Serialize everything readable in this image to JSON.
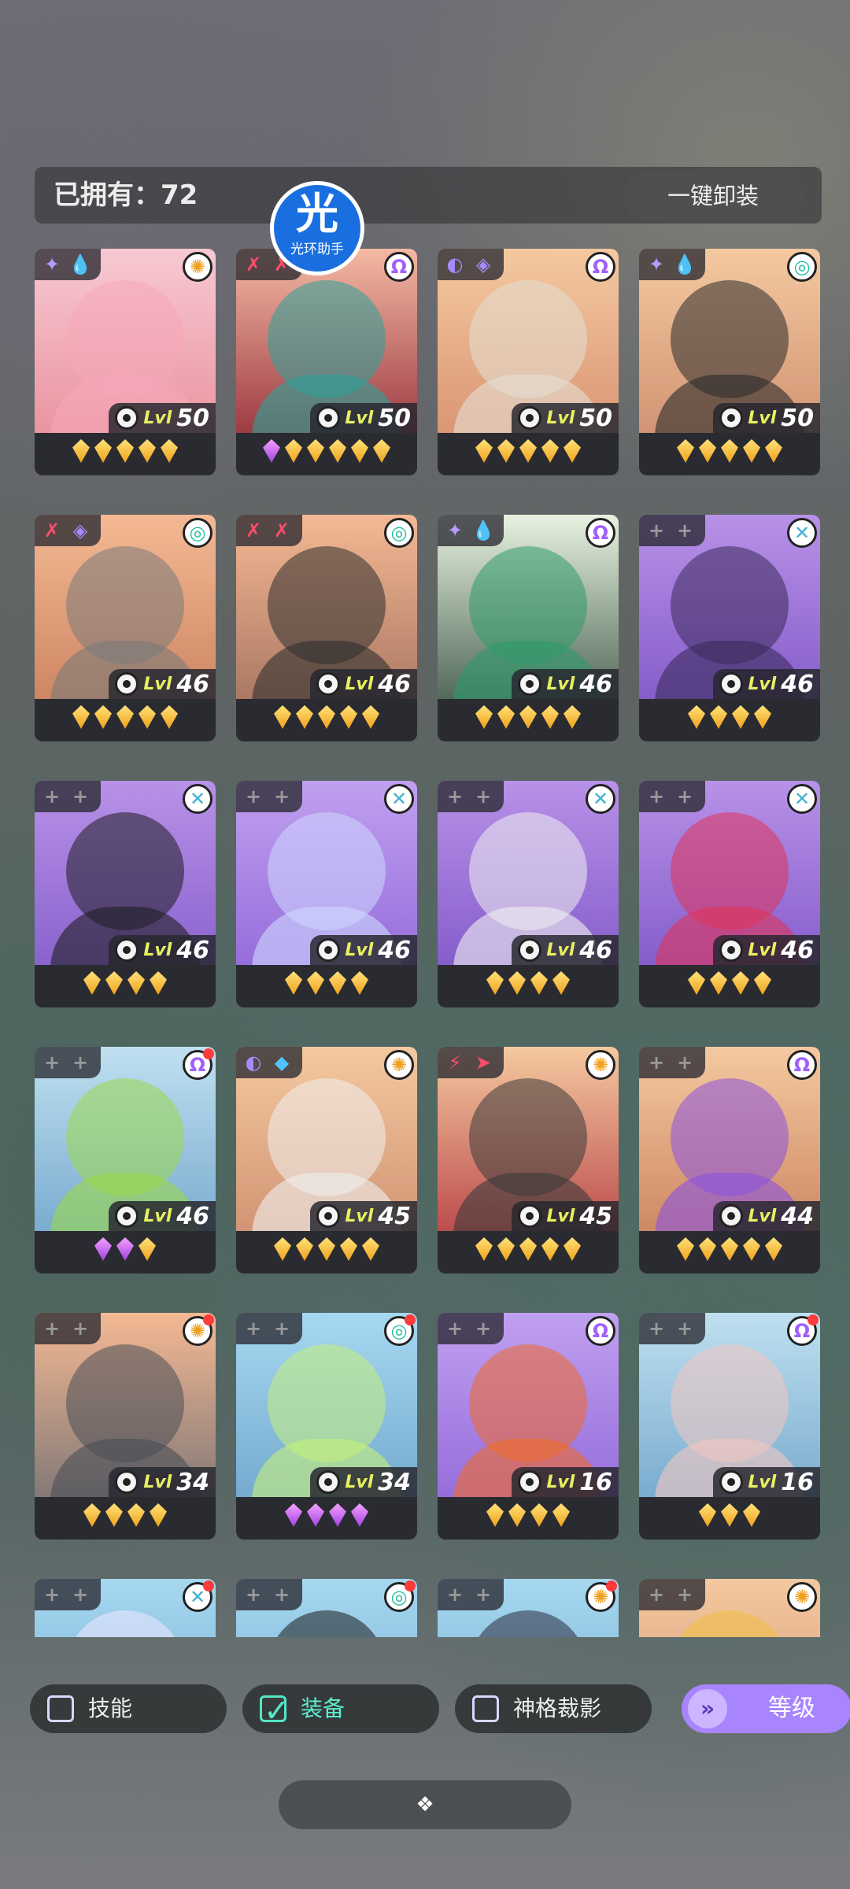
{
  "header": {
    "owned_label": "已拥有：72",
    "unequip_label": "一键卸装"
  },
  "assistant": {
    "glyph": "光",
    "label": "光环助手"
  },
  "heroes": [
    {
      "level": "50",
      "top": "#f7c9d2",
      "bottom": "#e88895",
      "tint": "#f6a7b8",
      "cls": "sun",
      "stars": [
        "g",
        "g",
        "g",
        "g",
        "g"
      ],
      "dot": false,
      "icons": [
        "✦",
        "💧"
      ],
      "iconColors": [
        "#b49bff",
        "#4fc3ff"
      ]
    },
    {
      "level": "50",
      "top": "#f4b9a3",
      "bottom": "#8a1e2e",
      "tint": "#2aa39a",
      "cls": "omega",
      "stars": [
        "p",
        "g",
        "g",
        "g",
        "g",
        "g"
      ],
      "dot": false,
      "icons": [
        "✗",
        "✗"
      ],
      "iconColors": [
        "#ff4d6d",
        "#ff4d6d"
      ]
    },
    {
      "level": "50",
      "top": "#f4c9a0",
      "bottom": "#d48a6a",
      "tint": "#e4e0d6",
      "cls": "omega",
      "stars": [
        "g",
        "g",
        "g",
        "g",
        "g"
      ],
      "dot": false,
      "icons": [
        "◐",
        "◈"
      ],
      "iconColors": [
        "#a58bff",
        "#a58bff"
      ]
    },
    {
      "level": "50",
      "top": "#f4c9a0",
      "bottom": "#c9886a",
      "tint": "#2a2a2a",
      "cls": "swirl",
      "stars": [
        "g",
        "g",
        "g",
        "g",
        "g"
      ],
      "dot": false,
      "icons": [
        "✦",
        "💧"
      ],
      "iconColors": [
        "#b49bff",
        "#4fc3ff"
      ]
    },
    {
      "level": "46",
      "top": "#f4b994",
      "bottom": "#c57a58",
      "tint": "#7a7a7a",
      "cls": "swirl",
      "stars": [
        "g",
        "g",
        "g",
        "g",
        "g"
      ],
      "dot": false,
      "icons": [
        "✗",
        "◈"
      ],
      "iconColors": [
        "#ff4d6d",
        "#a58bff"
      ]
    },
    {
      "level": "46",
      "top": "#f4b994",
      "bottom": "#9a6a58",
      "tint": "#2e2e2e",
      "cls": "swirl",
      "stars": [
        "g",
        "g",
        "g",
        "g",
        "g"
      ],
      "dot": false,
      "icons": [
        "✗",
        "✗"
      ],
      "iconColors": [
        "#ff4d6d",
        "#ff4d6d"
      ]
    },
    {
      "level": "46",
      "top": "#e8f2e0",
      "bottom": "#2f4a3a",
      "tint": "#2f9a6a",
      "cls": "omega",
      "stars": [
        "g",
        "g",
        "g",
        "g",
        "g"
      ],
      "dot": false,
      "icons": [
        "✦",
        "💧"
      ],
      "iconColors": [
        "#b49bff",
        "#4fc3ff"
      ]
    },
    {
      "level": "46",
      "top": "#b891e8",
      "bottom": "#7a52c4",
      "tint": "#3a2a5a",
      "cls": "cross",
      "stars": [
        "g",
        "g",
        "g",
        "g"
      ],
      "dot": false,
      "icons": [
        "+",
        "+"
      ],
      "iconColors": [
        "#9a9a9a",
        "#9a9a9a"
      ]
    },
    {
      "level": "46",
      "top": "#b891e8",
      "bottom": "#8058c8",
      "tint": "#1e1e22",
      "cls": "cross",
      "stars": [
        "g",
        "g",
        "g",
        "g"
      ],
      "dot": false,
      "icons": [
        "+",
        "+"
      ],
      "iconColors": [
        "#9a9a9a",
        "#9a9a9a"
      ]
    },
    {
      "level": "46",
      "top": "#c0a0f0",
      "bottom": "#8c62d6",
      "tint": "#cfd8ff",
      "cls": "cross",
      "stars": [
        "g",
        "g",
        "g",
        "g"
      ],
      "dot": false,
      "icons": [
        "+",
        "+"
      ],
      "iconColors": [
        "#9a9a9a",
        "#9a9a9a"
      ]
    },
    {
      "level": "46",
      "top": "#b891e8",
      "bottom": "#7a52c4",
      "tint": "#f0f0f0",
      "cls": "cross",
      "stars": [
        "g",
        "g",
        "g",
        "g"
      ],
      "dot": false,
      "icons": [
        "+",
        "+"
      ],
      "iconColors": [
        "#9a9a9a",
        "#9a9a9a"
      ]
    },
    {
      "level": "46",
      "top": "#b891e8",
      "bottom": "#7a52c4",
      "tint": "#e0335a",
      "cls": "cross",
      "stars": [
        "g",
        "g",
        "g",
        "g"
      ],
      "dot": false,
      "icons": [
        "+",
        "+"
      ],
      "iconColors": [
        "#9a9a9a",
        "#9a9a9a"
      ]
    },
    {
      "level": "46",
      "top": "#bfe0f0",
      "bottom": "#6aa0c8",
      "tint": "#9ad84a",
      "cls": "omega",
      "stars": [
        "p",
        "p",
        "g"
      ],
      "dot": true,
      "icons": [
        "+",
        "+"
      ],
      "iconColors": [
        "#9a9a9a",
        "#9a9a9a"
      ]
    },
    {
      "level": "45",
      "top": "#f4c9a0",
      "bottom": "#c9886a",
      "tint": "#f0f0f0",
      "cls": "sun",
      "stars": [
        "g",
        "g",
        "g",
        "g",
        "g"
      ],
      "dot": false,
      "icons": [
        "◐",
        "◆"
      ],
      "iconColors": [
        "#a58bff",
        "#4fc3ff"
      ]
    },
    {
      "level": "45",
      "top": "#f4c9a0",
      "bottom": "#b0303a",
      "tint": "#3a3a3a",
      "cls": "sun",
      "stars": [
        "g",
        "g",
        "g",
        "g",
        "g"
      ],
      "dot": false,
      "icons": [
        "⚡",
        "➤"
      ],
      "iconColors": [
        "#ff4d6d",
        "#ff4d6d"
      ]
    },
    {
      "level": "44",
      "top": "#f4c9a0",
      "bottom": "#c57a58",
      "tint": "#8a52e0",
      "cls": "omega",
      "stars": [
        "g",
        "g",
        "g",
        "g",
        "g"
      ],
      "dot": false,
      "icons": [
        "+",
        "+"
      ],
      "iconColors": [
        "#9a9a9a",
        "#9a9a9a"
      ]
    },
    {
      "level": "34",
      "top": "#f4b994",
      "bottom": "#6a6a70",
      "tint": "#4a4e56",
      "cls": "sun",
      "stars": [
        "g",
        "g",
        "g",
        "g"
      ],
      "dot": true,
      "icons": [
        "+",
        "+"
      ],
      "iconColors": [
        "#9a9a9a",
        "#9a9a9a"
      ]
    },
    {
      "level": "34",
      "top": "#a6d8f0",
      "bottom": "#6aa0c8",
      "tint": "#c6f07a",
      "cls": "swirl",
      "stars": [
        "p",
        "p",
        "p",
        "p"
      ],
      "dot": true,
      "icons": [
        "+",
        "+"
      ],
      "iconColors": [
        "#9a9a9a",
        "#9a9a9a"
      ]
    },
    {
      "level": "16",
      "top": "#c0a0f0",
      "bottom": "#8c62d6",
      "tint": "#f06a2a",
      "cls": "omega",
      "stars": [
        "g",
        "g",
        "g",
        "g"
      ],
      "dot": false,
      "icons": [
        "+",
        "+"
      ],
      "iconColors": [
        "#9a9a9a",
        "#9a9a9a"
      ]
    },
    {
      "level": "16",
      "top": "#bfe0f0",
      "bottom": "#6aa0c8",
      "tint": "#f4c6c0",
      "cls": "omega",
      "stars": [
        "g",
        "g",
        "g"
      ],
      "dot": true,
      "icons": [
        "+",
        "+"
      ],
      "iconColors": [
        "#9a9a9a",
        "#9a9a9a"
      ]
    },
    {
      "level": "",
      "top": "#a6d8f0",
      "bottom": "#6aa0c8",
      "tint": "#f0e8ff",
      "cls": "cross",
      "stars": [],
      "dot": true,
      "icons": [
        "+",
        "+"
      ],
      "iconColors": [
        "#9a9a9a",
        "#9a9a9a"
      ]
    },
    {
      "level": "",
      "top": "#a6d8f0",
      "bottom": "#6aa0c8",
      "tint": "#1a1a1a",
      "cls": "swirl",
      "stars": [],
      "dot": true,
      "icons": [
        "+",
        "+"
      ],
      "iconColors": [
        "#9a9a9a",
        "#9a9a9a"
      ]
    },
    {
      "level": "",
      "top": "#a6d8f0",
      "bottom": "#6aa0c8",
      "tint": "#2a2a3a",
      "cls": "sun",
      "stars": [],
      "dot": true,
      "icons": [
        "+",
        "+"
      ],
      "iconColors": [
        "#9a9a9a",
        "#9a9a9a"
      ]
    },
    {
      "level": "",
      "top": "#f4c9a0",
      "bottom": "#c9886a",
      "tint": "#f0c040",
      "cls": "sun",
      "stars": [],
      "dot": false,
      "icons": [
        "+",
        "+"
      ],
      "iconColors": [
        "#9a9a9a",
        "#9a9a9a"
      ]
    }
  ],
  "level_prefix": "Lvl",
  "class_icons": {
    "sun": "✺",
    "omega": "Ω",
    "swirl": "◎",
    "cross": "✕"
  },
  "class_colors": {
    "sun": "#f0a020",
    "omega": "#a060ff",
    "swirl": "#20c0a0",
    "cross": "#40b0d0"
  },
  "filters": {
    "skill": "技能",
    "equipment": "装备",
    "divinity": "神格裁影",
    "sort": "等级"
  },
  "sort_icon": "»",
  "more_icon": "❖"
}
